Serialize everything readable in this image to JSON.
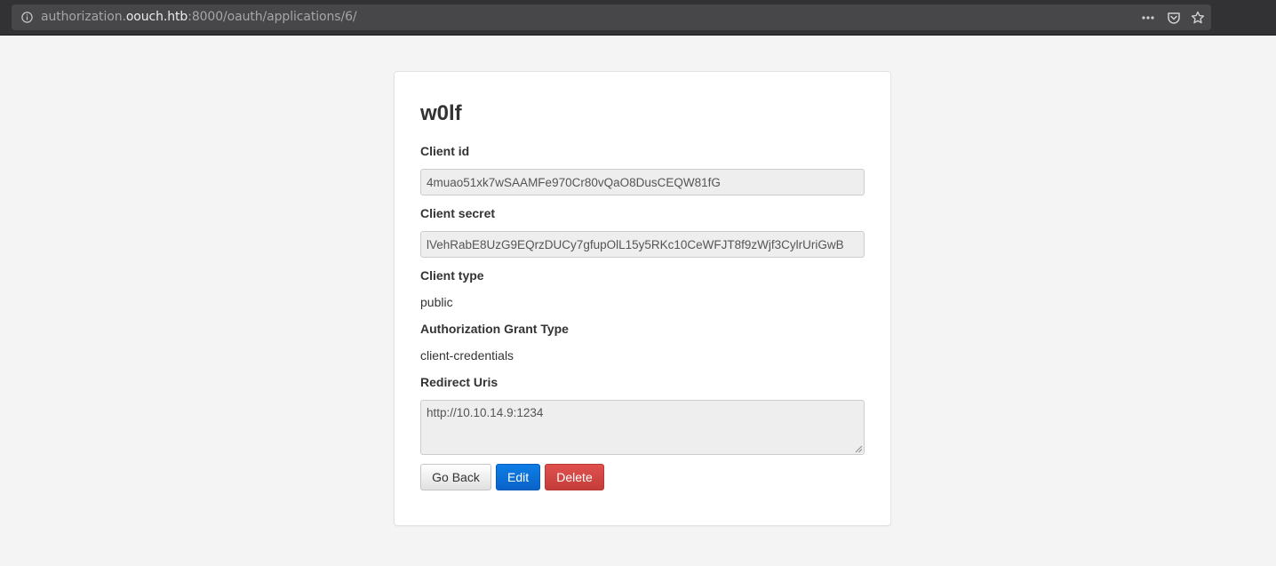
{
  "browser": {
    "url_prefix": "authorization.",
    "url_host": "oouch.htb",
    "url_suffix": ":8000/oauth/applications/6/",
    "icons": [
      "info-icon",
      "more-icon",
      "pocket-icon",
      "star-icon"
    ]
  },
  "app": {
    "name": "w0lf",
    "client_id_label": "Client id",
    "client_id": "4muao51xk7wSAAMFe970Cr80vQaO8DusCEQW81fG",
    "client_secret_label": "Client secret",
    "client_secret": "lVehRabE8UzG9EQrzDUCy7gfupOlL15y5RKc10CeWFJT8f9zWjf3CylrUriGwB",
    "client_type_label": "Client type",
    "client_type": "public",
    "grant_type_label": "Authorization Grant Type",
    "grant_type": "client-credentials",
    "redirect_uris_label": "Redirect Uris",
    "redirect_uris": "http://10.10.14.9:1234"
  },
  "buttons": {
    "go_back": "Go Back",
    "edit": "Edit",
    "delete": "Delete"
  },
  "colors": {
    "primary": "#0a6fd6",
    "danger": "#d9534f",
    "page_bg": "#f4f4f4"
  }
}
